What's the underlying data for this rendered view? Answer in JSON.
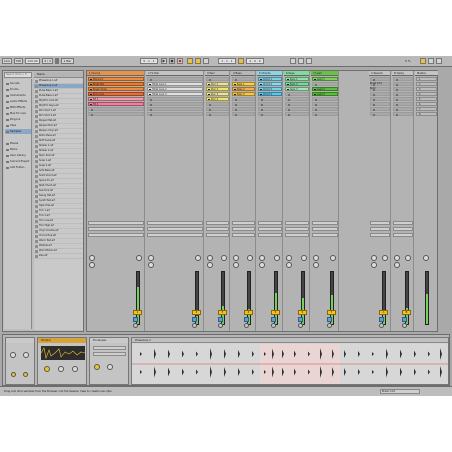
{
  "topbar": {
    "link": "Link",
    "tap": "TAP",
    "tempo": "120.00",
    "signature": "4 / 4",
    "quantize": "1 Bar",
    "position": "5 . 1 . 1",
    "loop_start": "1 . 1 . 1",
    "loop_len": "4 . 0 . 0",
    "cpu": "5 %"
  },
  "browser": {
    "search_placeholder": "Search (Cmd + F)",
    "column_header": "Name",
    "places": [
      "Sounds",
      "Drums",
      "Instruments",
      "Audio Effects",
      "MIDI Effects",
      "Max for Live",
      "Plug-ins",
      "Clips",
      "Samples",
      "Places",
      "Packs",
      "User Library",
      "Current Project",
      "Add Folder..."
    ],
    "files": [
      "Phaseloop 1.aif",
      "Phaseloop 2.aif",
      "Pulse Bass 1.aif",
      "Pulse Bass 2.aif",
      "Rhythm Acid.aif",
      "Rhythm Keys.aif",
      "Rim Shot 1.aif",
      "Rim Shot 2.aif",
      "Ripped Hat.aif",
      "Ripped Kick.aif",
      "Rippen Vinyl.aif",
      "Rollin Bass.aif",
      "Ruff Snare.aif",
      "Shaker 1.aif",
      "Shaker 2.aif",
      "Slam Kick.aif",
      "Snap 1.aif",
      "Snap 2.aif",
      "Sofa Bass.aif",
      "Solid Chord.aif",
      "Space Fx.aif",
      "Stab Chord.aif",
      "Sub Kick.aif",
      "Swing Hat.aif",
      "Synth Pad.aif",
      "Tape Hiss.aif",
      "Tick 1.aif",
      "Tick 2.aif",
      "Tom Low.aif",
      "Tom High.aif",
      "Vinyl Crackle.aif",
      "Vocal Chop.aif",
      "Warm Pad.aif",
      "Wobble.aif",
      "Wood Block.aif",
      "Zap.aif"
    ]
  },
  "tracks": [
    {
      "name": "1 Drums",
      "color": "#e8934a",
      "clips": [
        [
          "Mainkick",
          "#f08a3c"
        ],
        [
          "Break Big",
          "#e97a2e"
        ],
        [
          "Break Small",
          "#f08a3c"
        ],
        [
          "Kick Loop",
          "#e46d3a"
        ],
        [
          "Fill 1",
          "#f59aa6"
        ],
        [
          "Fill 2",
          "#f07ea0"
        ]
      ],
      "num": "1"
    },
    {
      "name": "2 Hi-Hat",
      "color": "#c3c3c3",
      "clips": [
        [
          "",
          ""
        ],
        [
          "Hihat Loop 1",
          "#e0e0e0"
        ],
        [
          "Hihat Loop 2",
          "#e0e0e0"
        ],
        [
          "Hihat Loop 3",
          "#e0e0e0"
        ],
        [
          "",
          ""
        ],
        [
          "",
          ""
        ]
      ],
      "num": "2"
    },
    {
      "name": "3 Perc",
      "color": "#bcbcbc",
      "clips": [
        [
          "",
          ""
        ],
        [
          "Perc 1",
          "#ece2a0"
        ],
        [
          "Perc 2",
          "#f3e36a"
        ],
        [
          "Perc 3",
          "#ece2a0"
        ],
        [
          "Perc 4",
          "#f3e36a"
        ],
        [
          "",
          ""
        ]
      ],
      "num": "3"
    },
    {
      "name": "4 Bass",
      "color": "#b7b7b7",
      "clips": [
        [
          "",
          ""
        ],
        [
          "Bass 1",
          "#f7d24a"
        ],
        [
          "Bass 2",
          "#f7b04a"
        ],
        [
          "Bass 3",
          "#f6c84a"
        ],
        [
          "",
          ""
        ],
        [
          "",
          ""
        ]
      ],
      "num": "4"
    },
    {
      "name": "5 Chords",
      "color": "#8bd5e9",
      "clips": [
        [
          "Chord 1",
          "#79d1eb"
        ],
        [
          "Chord 2",
          "#8bd7ee"
        ],
        [
          "Chord 3",
          "#79d1eb"
        ],
        [
          "Chord 4",
          "#5bc7e8"
        ],
        [
          "",
          ""
        ],
        [
          "",
          ""
        ]
      ],
      "num": "5"
    },
    {
      "name": "6 Keys",
      "color": "#7fdc9a",
      "clips": [
        [
          "Keys 1",
          "#8ee3a6"
        ],
        [
          "Keys 2",
          "#7adb97"
        ],
        [
          "Keys 3",
          "#a2e8b6"
        ],
        [
          "",
          ""
        ],
        [
          "",
          ""
        ],
        [
          "",
          ""
        ]
      ],
      "num": "6"
    },
    {
      "name": "7 Lead",
      "color": "#67c346",
      "clips": [
        [
          "Lead 1",
          "#7bd25a"
        ],
        [
          "",
          ""
        ],
        [
          "Lead 2",
          "#5bbf3c"
        ],
        [
          "Lead 3",
          "#5bbf3c"
        ],
        [
          "",
          ""
        ],
        [
          "",
          ""
        ]
      ],
      "num": "7"
    },
    {
      "name": "A Reverb",
      "color": "#c4c4c4",
      "clips": [],
      "num": "A"
    },
    {
      "name": "B Delay",
      "color": "#c4c4c4",
      "clips": [],
      "num": "B"
    }
  ],
  "master": {
    "name": "Master",
    "scenes": [
      "1",
      "2",
      "3",
      "4",
      "5",
      "6",
      "7",
      "8"
    ],
    "scene_labels": [
      "Break Intro",
      "Build",
      "",
      "",
      "",
      "",
      "",
      ""
    ]
  },
  "detail": {
    "device1": "Simpler",
    "device2": "Envelopes",
    "clip_title": "Phaseloop 2"
  },
  "status": {
    "hint": "Drag and drop samples from the Browser into the Session View to create new clips.",
    "right": "Break Intro"
  }
}
